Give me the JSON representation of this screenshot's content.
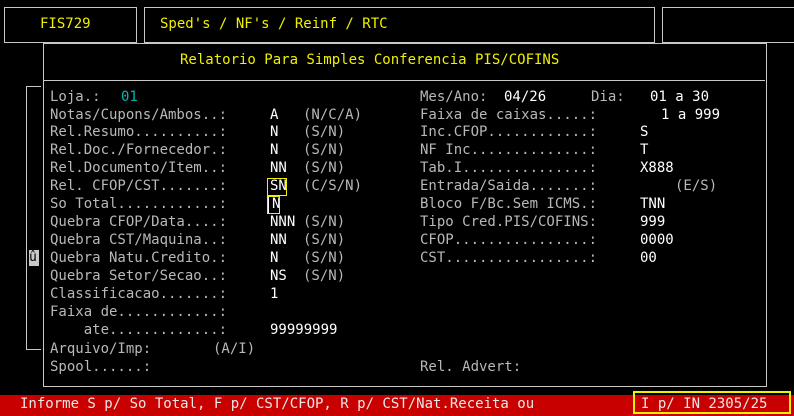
{
  "header": {
    "program_code": "FIS729",
    "module_title": "Sped's / NF's / Reinf / RTC"
  },
  "dialog": {
    "title": "Relatorio Para Simples Conferencia PIS/COFINS",
    "side_icon": "û"
  },
  "left_fields": [
    {
      "label": "Loja.:",
      "value": "01",
      "hint": ""
    },
    {
      "label": "Notas/Cupons/Ambos..:",
      "value": "A",
      "hint": "(N/C/A)"
    },
    {
      "label": "Rel.Resumo..........:",
      "value": "N",
      "hint": "(S/N)"
    },
    {
      "label": "Rel.Doc./Fornecedor.:",
      "value": "N",
      "hint": "(S/N)"
    },
    {
      "label": "Rel.Documento/Item..:",
      "value": "NN",
      "hint": "(S/N)"
    },
    {
      "label": "Rel. CFOP/CST.......:",
      "value": "SN",
      "hint": "(C/S/N)"
    },
    {
      "label": "So Total............:",
      "value": "N",
      "hint": ""
    },
    {
      "label": "Quebra CFOP/Data....:",
      "value": "NNN",
      "hint": "(S/N)"
    },
    {
      "label": "Quebra CST/Maquina..:",
      "value": "NN",
      "hint": "(S/N)"
    },
    {
      "label": "Quebra Natu.Credito.:",
      "value": "N",
      "hint": "(S/N)"
    },
    {
      "label": "Quebra Setor/Secao..:",
      "value": "NS",
      "hint": "(S/N)"
    },
    {
      "label": "Classificacao.......:",
      "value": "1",
      "hint": ""
    },
    {
      "label": "Faixa de............:",
      "value": "",
      "hint": ""
    },
    {
      "label": "    ate.............:",
      "value": "99999999",
      "hint": ""
    },
    {
      "label": "Arquivo/Imp:",
      "value": "",
      "hint": "(A/I)"
    },
    {
      "label": "Spool......:",
      "value": "",
      "hint": ""
    }
  ],
  "right_fields": [
    {
      "label": "Mes/Ano:",
      "value": "04/26",
      "label2": "Dia:",
      "value2": "01 a 30"
    },
    {
      "label": "Faixa de caixas.....:",
      "value": "1 a 999"
    },
    {
      "label": "Inc.CFOP............:",
      "value": "S"
    },
    {
      "label": "NF Inc..............:",
      "value": "T"
    },
    {
      "label": "Tab.I...............:",
      "value": "X888"
    },
    {
      "label": "Entrada/Saida.......:",
      "value": "(E/S)"
    },
    {
      "label": "Bloco F/Bc.Sem ICMS.:",
      "value": "TNN"
    },
    {
      "label": "Tipo Cred.PIS/COFINS:",
      "value": "999"
    },
    {
      "label": "CFOP................:",
      "value": "0000"
    },
    {
      "label": "CST.................:",
      "value": "00"
    },
    {
      "label": "Rel. Advert:",
      "value": ""
    }
  ],
  "status_bar": {
    "message": "Informe S p/ So Total, F p/ CST/CFOP, R p/ CST/Nat.Receita ou",
    "message_end": "I p/ IN 2305/25"
  },
  "colors": {
    "background": "#000000",
    "title_yellow": "#f0f000",
    "label_gray": "#b8b8b8",
    "value_white": "#ffffff",
    "store_cyan": "#00b8b8",
    "status_red": "#c80000"
  }
}
